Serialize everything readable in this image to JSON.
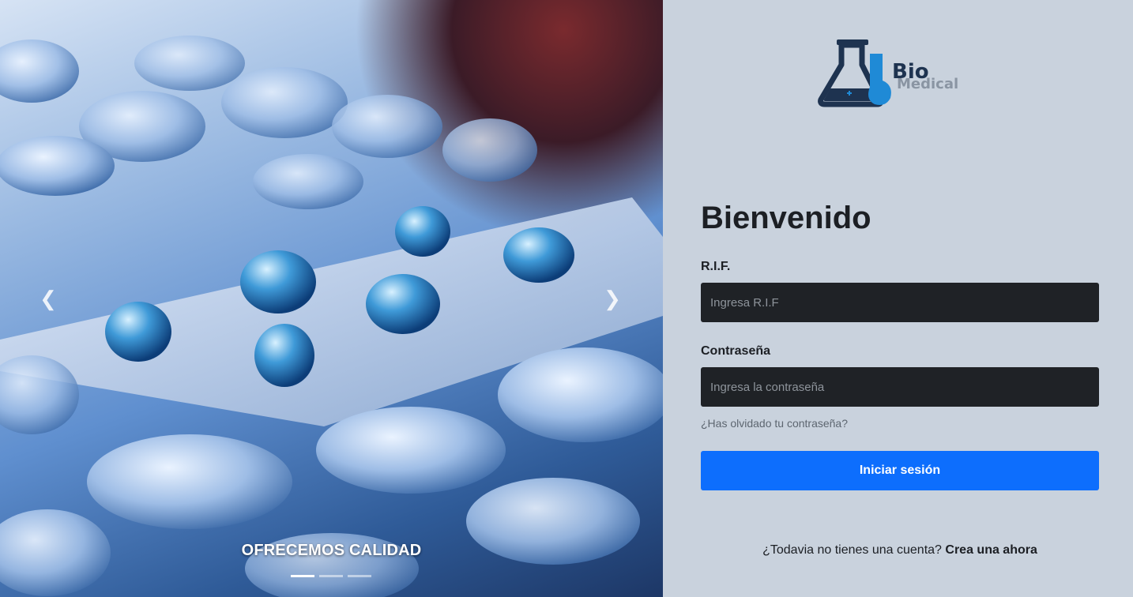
{
  "carousel": {
    "caption": "OFRECEMOS CALIDAD",
    "prev_icon": "chevron-left-icon",
    "next_icon": "chevron-right-icon",
    "indicators": [
      "slide-1",
      "slide-2",
      "slide-3"
    ],
    "active_index": 0
  },
  "brand": {
    "bio": "Bio",
    "medical": "Medical",
    "icon": "flask-icon",
    "colors": {
      "navy": "#1e3350",
      "blue": "#1f8ad6",
      "gray": "#8a95a3"
    }
  },
  "login": {
    "title": "Bienvenido",
    "rif_label": "R.I.F.",
    "rif_placeholder": "Ingresa R.I.F",
    "password_label": "Contraseña",
    "password_placeholder": "Ingresa la contraseña",
    "forgot_link": "¿Has olvidado tu contraseña?",
    "submit_label": "Iniciar sesión",
    "signup_prompt": "¿Todavia no tienes una cuenta?",
    "signup_link": "Crea una ahora"
  },
  "colors": {
    "panel_bg": "#c9d2dd",
    "input_bg": "#1f2226",
    "primary": "#0d6efd"
  }
}
